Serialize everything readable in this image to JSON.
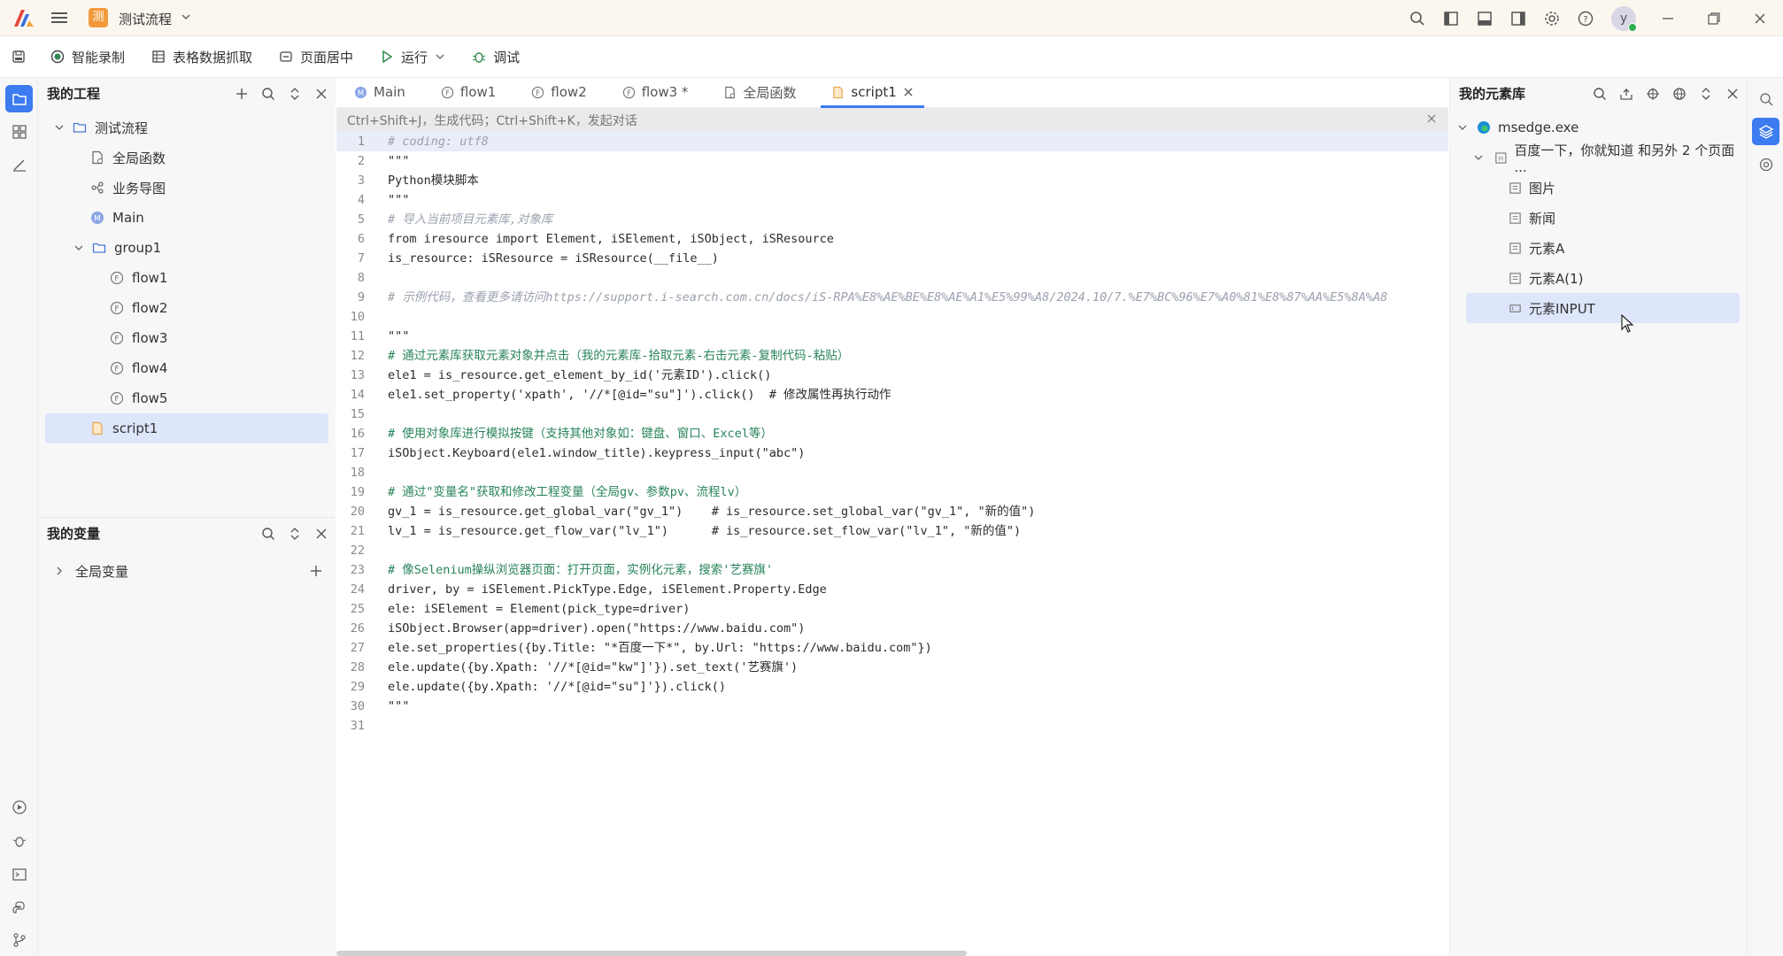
{
  "titlebar": {
    "project_badge": "测",
    "project_name": "测试流程",
    "avatar_letter": "y"
  },
  "toolbar": {
    "smart_record": "智能录制",
    "table_scrape": "表格数据抓取",
    "page_center": "页面居中",
    "run": "运行",
    "debug": "调试"
  },
  "project_panel": {
    "title": "我的工程",
    "tree": [
      {
        "label": "测试流程",
        "kind": "folder",
        "expanded": true
      },
      {
        "label": "全局函数",
        "kind": "func"
      },
      {
        "label": "业务导图",
        "kind": "map"
      },
      {
        "label": "Main",
        "kind": "main"
      },
      {
        "label": "group1",
        "kind": "folder",
        "expanded": true
      },
      {
        "label": "flow1",
        "kind": "flow"
      },
      {
        "label": "flow2",
        "kind": "flow"
      },
      {
        "label": "flow3",
        "kind": "flow"
      },
      {
        "label": "flow4",
        "kind": "flow"
      },
      {
        "label": "flow5",
        "kind": "flow"
      },
      {
        "label": "script1",
        "kind": "script",
        "selected": true
      }
    ]
  },
  "vars_panel": {
    "title": "我的变量",
    "global_vars": "全局变量"
  },
  "tabs": [
    {
      "label": "Main",
      "kind": "main"
    },
    {
      "label": "flow1",
      "kind": "flow"
    },
    {
      "label": "flow2",
      "kind": "flow"
    },
    {
      "label": "flow3 *",
      "kind": "flow"
    },
    {
      "label": "全局函数",
      "kind": "func"
    },
    {
      "label": "script1",
      "kind": "script",
      "active": true
    }
  ],
  "hint": "Ctrl+Shift+J，生成代码；Ctrl+Shift+K，发起对话",
  "code_lines": [
    "# coding: utf8",
    "\"\"\"",
    "Python模块脚本",
    "\"\"\"",
    "# 导入当前项目元素库,对象库",
    "from iresource import Element, iSElement, iSObject, iSResource",
    "is_resource: iSResource = iSResource(__file__)",
    "",
    "# 示例代码，查看更多请访问https://support.i-search.com.cn/docs/iS-RPA%E8%AE%BE%E8%AE%A1%E5%99%A8/2024.10/7.%E7%BC%96%E7%A0%81%E8%87%AA%E5%8A%A8",
    "",
    "\"\"\"",
    "# 通过元素库获取元素对象并点击（我的元素库-拾取元素-右击元素-复制代码-粘贴）",
    "ele1 = is_resource.get_element_by_id('元素ID').click()",
    "ele1.set_property('xpath', '//*[@id=\"su\"]').click()  # 修改属性再执行动作",
    "",
    "# 使用对象库进行模拟按键（支持其他对象如：键盘、窗口、Excel等）",
    "iSObject.Keyboard(ele1.window_title).keypress_input(\"abc\")",
    "",
    "# 通过\"变量名\"获取和修改工程变量（全局gv、参数pv、流程lv）",
    "gv_1 = is_resource.get_global_var(\"gv_1\")    # is_resource.set_global_var(\"gv_1\", \"新的值\")",
    "lv_1 = is_resource.get_flow_var(\"lv_1\")      # is_resource.set_flow_var(\"lv_1\", \"新的值\")",
    "",
    "# 像Selenium操纵浏览器页面：打开页面，实例化元素，搜索'艺赛旗'",
    "driver, by = iSElement.PickType.Edge, iSElement.Property.Edge",
    "ele: iSElement = Element(pick_type=driver)",
    "iSObject.Browser(app=driver).open(\"https://www.baidu.com\")",
    "ele.set_properties({by.Title: \"*百度一下*\", by.Url: \"https://www.baidu.com\"})",
    "ele.update({by.Xpath: '//*[@id=\"kw\"]'}).set_text('艺赛旗')",
    "ele.update({by.Xpath: '//*[@id=\"su\"]'}).click()",
    "\"\"\"",
    ""
  ],
  "elem_panel": {
    "title": "我的元素库",
    "app": "msedge.exe",
    "page": "百度一下，你就知道 和另外 2 个页面 ...",
    "items": [
      "图片",
      "新闻",
      "元素A",
      "元素A(1)",
      "元素INPUT"
    ],
    "selected": "元素INPUT"
  },
  "colors": {
    "accent": "#3d7bf0",
    "selection": "#dde6fb",
    "comment": "#9aa1ad",
    "comment_green": "#28845a",
    "keyword": "#2b4fb3"
  }
}
